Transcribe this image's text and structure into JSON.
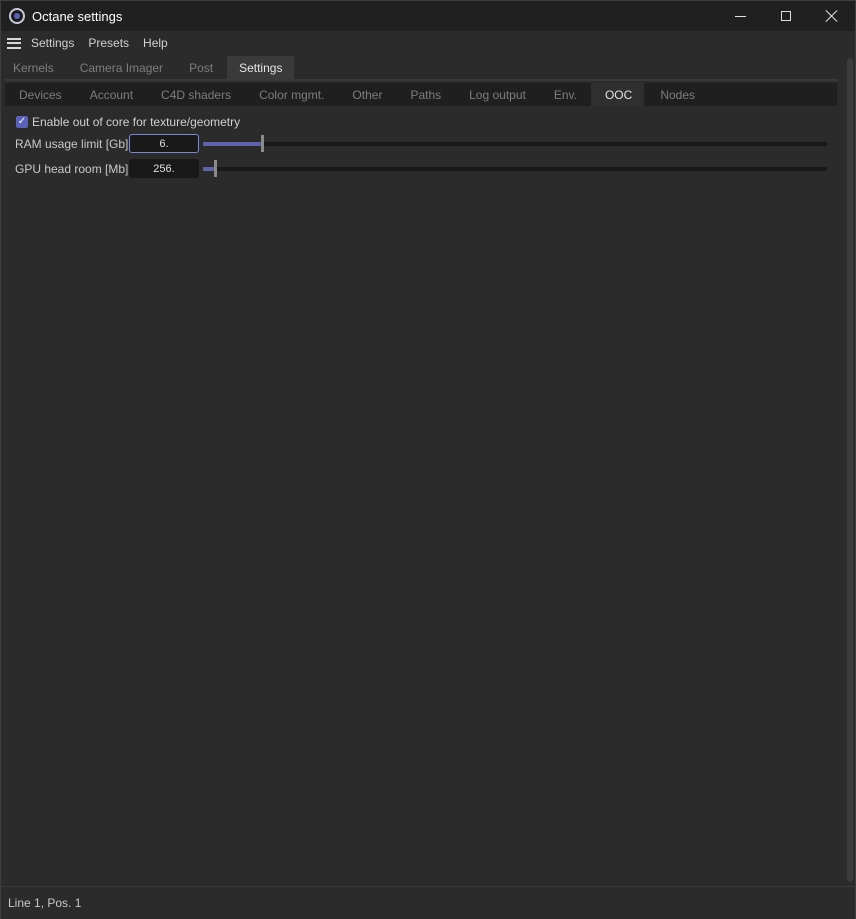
{
  "window": {
    "title": "Octane settings"
  },
  "menu": {
    "items": [
      "Settings",
      "Presets",
      "Help"
    ]
  },
  "main_tabs": [
    {
      "label": "Kernels",
      "active": false
    },
    {
      "label": "Camera Imager",
      "active": false
    },
    {
      "label": "Post",
      "active": false
    },
    {
      "label": "Settings",
      "active": true
    }
  ],
  "sub_tabs": [
    {
      "label": "Devices",
      "active": false
    },
    {
      "label": "Account",
      "active": false
    },
    {
      "label": "C4D shaders",
      "active": false
    },
    {
      "label": "Color mgmt.",
      "active": false
    },
    {
      "label": "Other",
      "active": false
    },
    {
      "label": "Paths",
      "active": false
    },
    {
      "label": "Log output",
      "active": false
    },
    {
      "label": "Env.",
      "active": false
    },
    {
      "label": "OOC",
      "active": true
    },
    {
      "label": "Nodes",
      "active": false
    }
  ],
  "ooc": {
    "enable_label": "Enable out of core for texture/geometry",
    "enable_checked": true,
    "ram_label": "RAM usage limit [Gb]",
    "ram_value": "6.",
    "ram_fill": 0.095,
    "gpu_label": "GPU head room [Mb]",
    "gpu_value": "256.",
    "gpu_fill": 0.02
  },
  "status": {
    "text": "Line 1, Pos. 1"
  },
  "colors": {
    "accent": "#5a63b8",
    "background": "#2b2b2b",
    "titlebar": "#202020"
  }
}
